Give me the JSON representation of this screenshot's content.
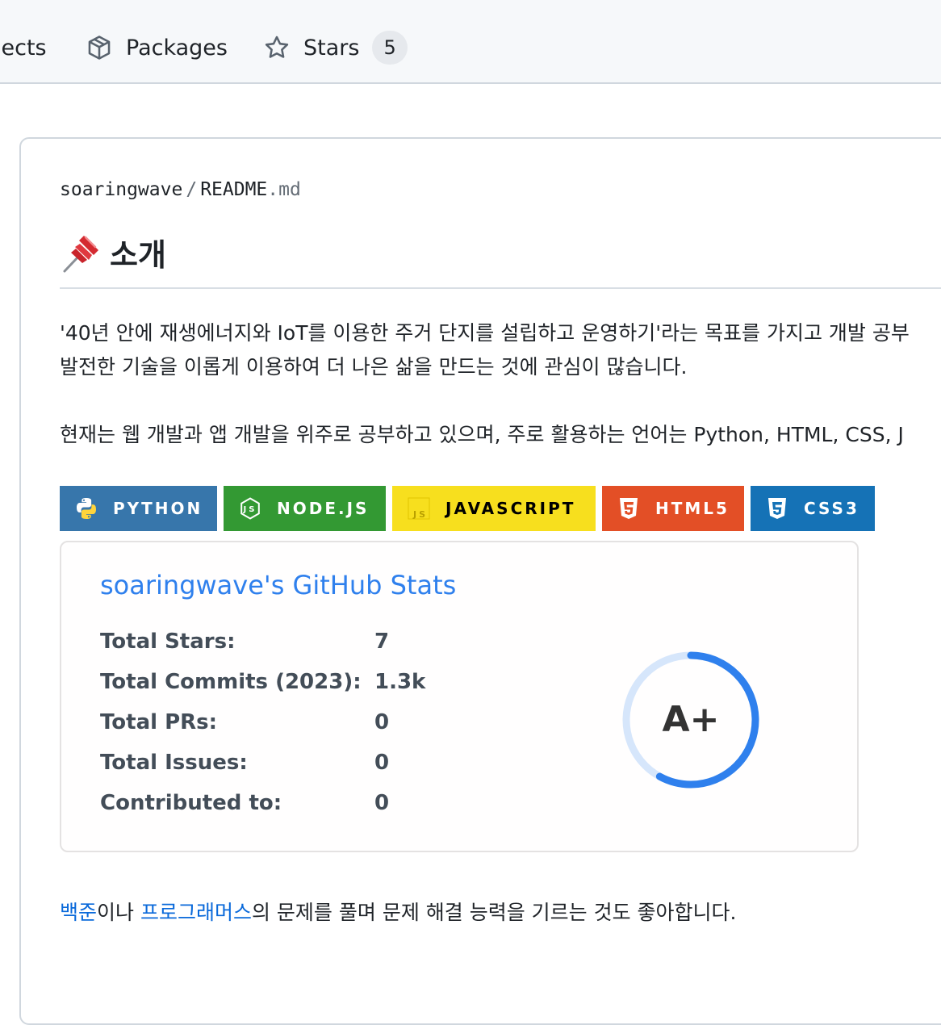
{
  "nav": {
    "items": [
      {
        "label": "jects"
      },
      {
        "label": "Packages",
        "icon": "package-icon"
      },
      {
        "label": "Stars",
        "icon": "star-icon",
        "count": "5"
      }
    ]
  },
  "readme": {
    "owner": "soaringwave",
    "separator": "/",
    "file_base": "README",
    "file_ext": ".md",
    "heading_icon": "pushpin-icon",
    "heading": "소개",
    "intro_line1": "'40년 안에 재생에너지와 IoT를 이용한 주거 단지를 설립하고 운영하기'라는 목표를 가지고 개발 공부",
    "intro_line2": "발전한 기술을 이롭게 이용하여 더 나은 삶을 만드는 것에 관심이 많습니다.",
    "current_line": "현재는 웹 개발과 앱 개발을 위주로 공부하고 있으며, 주로 활용하는 언어는 Python, HTML, CSS, J",
    "badges": [
      {
        "label": "PYTHON",
        "icon": "python-icon",
        "bg": "#3776ab",
        "fg": "#ffffff"
      },
      {
        "label": "NODE.JS",
        "icon": "nodejs-icon",
        "bg": "#339933",
        "fg": "#ffffff"
      },
      {
        "label": "JAVASCRIPT",
        "icon": "javascript-icon",
        "bg": "#f7df1e",
        "fg": "#000000"
      },
      {
        "label": "HTML5",
        "icon": "html5-icon",
        "bg": "#e34f26",
        "fg": "#ffffff"
      },
      {
        "label": "CSS3",
        "icon": "css3-icon",
        "bg": "#1572b6",
        "fg": "#ffffff"
      }
    ],
    "stats": {
      "title": "soaringwave's GitHub Stats",
      "rows": [
        {
          "label": "Total Stars:",
          "value": "7"
        },
        {
          "label": "Total Commits (2023):",
          "value": "1.3k"
        },
        {
          "label": "Total PRs:",
          "value": "0"
        },
        {
          "label": "Total Issues:",
          "value": "0"
        },
        {
          "label": "Contributed to:",
          "value": "0"
        }
      ],
      "rank": "A+",
      "rank_progress_fraction": 0.58,
      "accent": "#2f80ed"
    },
    "last_line": {
      "link1": "백준",
      "text1": "이나 ",
      "link2": "프로그래머스",
      "text2": "의 문제를 풀며 문제 해결 능력을 기르는 것도 좋아합니다."
    }
  }
}
